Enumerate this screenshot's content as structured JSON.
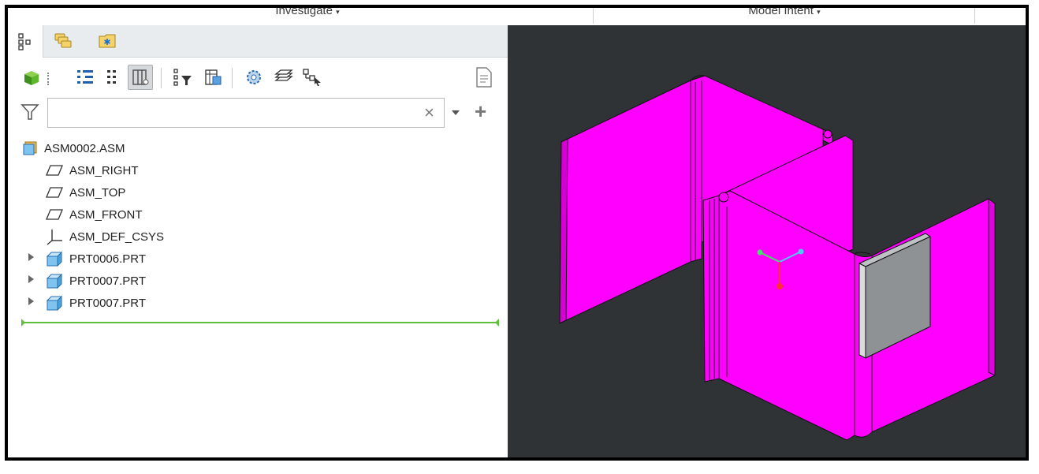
{
  "ribbon": {
    "groups": [
      {
        "label": "Investigate"
      },
      {
        "label": "Model Intent"
      }
    ]
  },
  "panel": {
    "tabs": [
      {
        "name": "model-tree",
        "icon": "model-tree-icon",
        "active": true
      },
      {
        "name": "folder-browser",
        "icon": "folder-browser-icon",
        "active": false
      },
      {
        "name": "favorites",
        "icon": "favorites-icon",
        "active": false
      }
    ],
    "search": {
      "value": "",
      "placeholder": "",
      "clear_symbol": "×",
      "add_symbol": "+"
    },
    "tree": [
      {
        "label": "ASM0002.ASM",
        "type": "assembly",
        "indent": 0,
        "expandable": false
      },
      {
        "label": "ASM_RIGHT",
        "type": "datum-plane",
        "indent": 1,
        "expandable": false
      },
      {
        "label": "ASM_TOP",
        "type": "datum-plane",
        "indent": 1,
        "expandable": false
      },
      {
        "label": "ASM_FRONT",
        "type": "datum-plane",
        "indent": 1,
        "expandable": false
      },
      {
        "label": "ASM_DEF_CSYS",
        "type": "csys",
        "indent": 1,
        "expandable": false
      },
      {
        "label": "PRT0006.PRT",
        "type": "part",
        "indent": 1,
        "expandable": true
      },
      {
        "label": "PRT0007.PRT",
        "type": "part",
        "indent": 1,
        "expandable": true
      },
      {
        "label": "PRT0007.PRT",
        "type": "part",
        "indent": 1,
        "expandable": true
      }
    ]
  },
  "viewport": {
    "background": "#2f3336",
    "part_color": "#ff00ff",
    "part_shadow": "#d000d0",
    "plate_color": "#8e9295"
  }
}
